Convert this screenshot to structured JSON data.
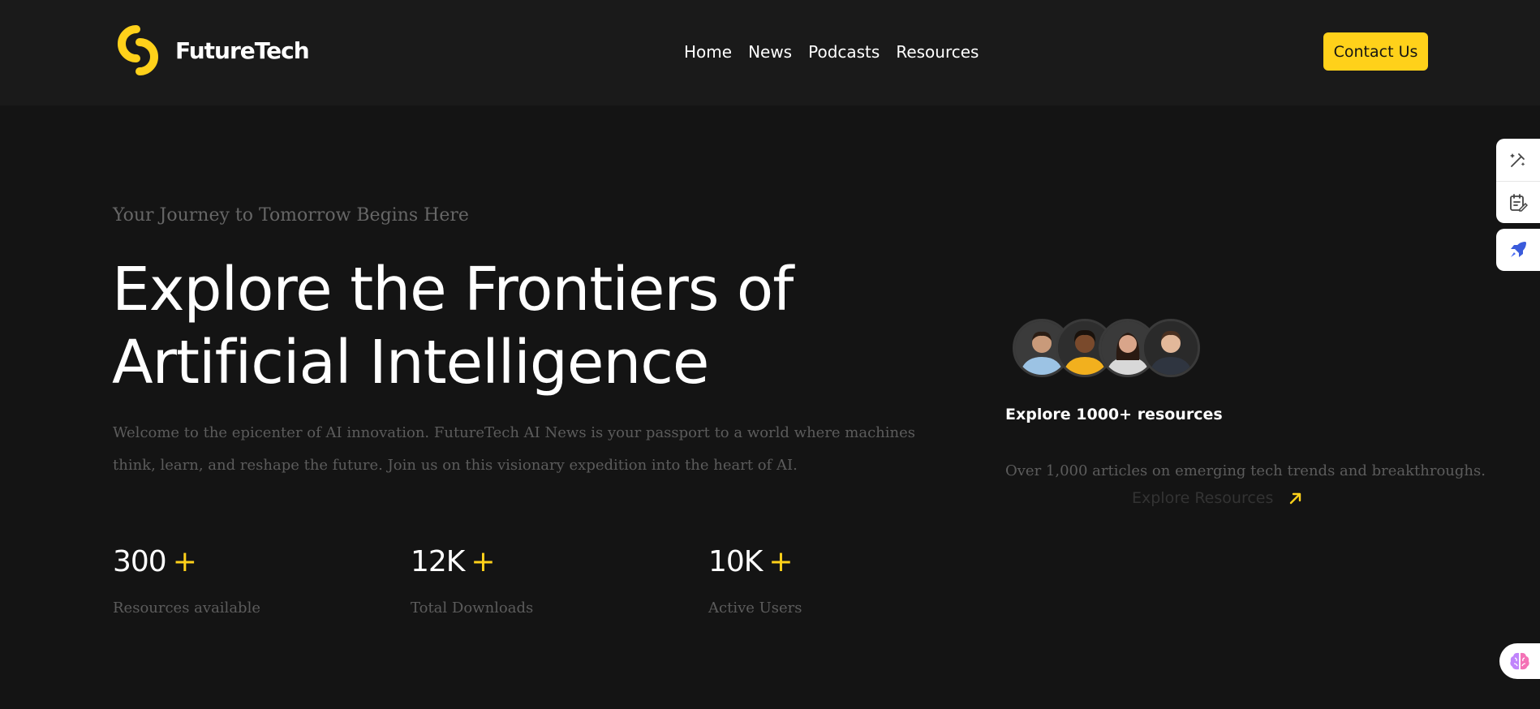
{
  "header": {
    "logo_text": "FutureTech",
    "nav": [
      "Home",
      "News",
      "Podcasts",
      "Resources"
    ],
    "contact_label": "Contact Us"
  },
  "hero": {
    "subtitle": "Your Journey to Tomorrow Begins Here",
    "title_line1": "Explore the Frontiers of",
    "title_line2": "Artificial Intelligence",
    "description": "Welcome to the epicenter of AI innovation. FutureTech AI News is your passport to a world where machines think, learn, and reshape the future. Join us on this visionary expedition into the heart of AI."
  },
  "stats": [
    {
      "value": "300",
      "plus": "+",
      "label": "Resources available"
    },
    {
      "value": "12K",
      "plus": "+",
      "label": "Total Downloads"
    },
    {
      "value": "10K",
      "plus": "+",
      "label": "Active Users"
    }
  ],
  "resources": {
    "title": "Explore 1000+ resources",
    "description": "Over 1,000 articles on emerging tech trends and breakthroughs.",
    "link_label": "Explore Resources"
  },
  "colors": {
    "accent": "#ffd11a",
    "background": "#141414",
    "header_background": "#1a1a1a",
    "muted_text": "#5c5c5c"
  },
  "icons": {
    "side_tools": [
      "magic-edit-icon",
      "notes-edit-icon",
      "rocket-icon",
      "brain-icon"
    ],
    "link_arrow": "arrow-up-right-icon"
  }
}
